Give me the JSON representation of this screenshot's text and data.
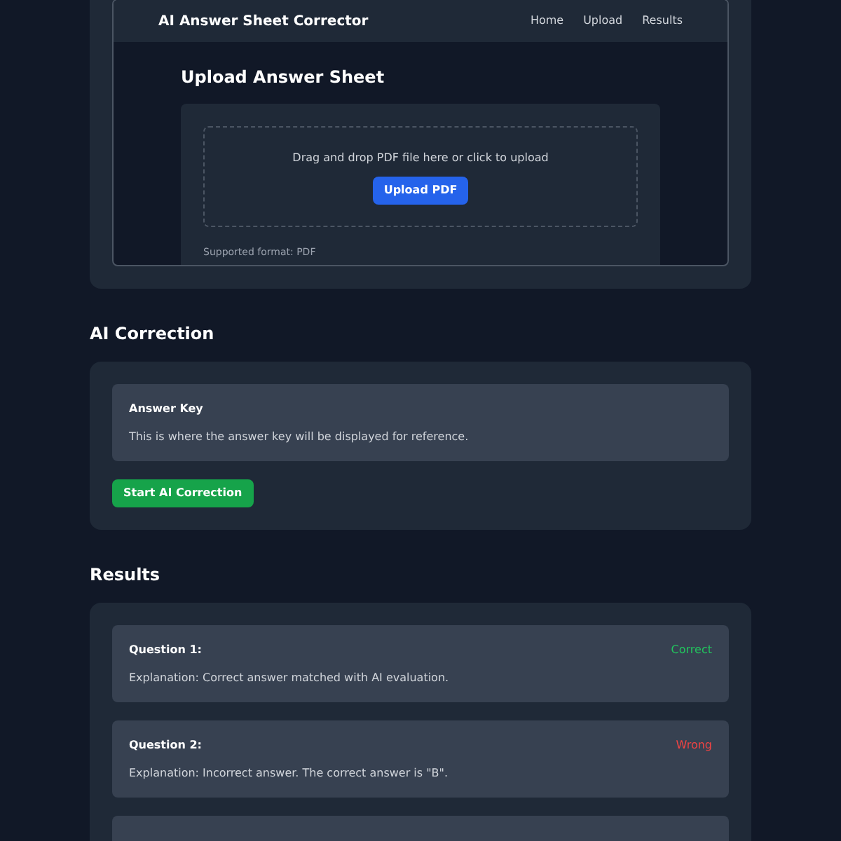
{
  "app_frame": {
    "nav": {
      "title": "AI Answer Sheet Corrector",
      "links": [
        "Home",
        "Upload",
        "Results"
      ]
    },
    "upload": {
      "heading": "Upload Answer Sheet",
      "drop_text": "Drag and drop PDF file here or click to upload",
      "button": "Upload PDF",
      "note": "Supported format: PDF"
    }
  },
  "correction": {
    "heading": "AI Correction",
    "answer_key": {
      "title": "Answer Key",
      "text": "This is where the answer key will be displayed for reference."
    },
    "button": "Start AI Correction"
  },
  "results": {
    "heading": "Results",
    "items": [
      {
        "question": "Question 1:",
        "status": "Correct",
        "kind": "correct",
        "explanation": "Explanation: Correct answer matched with AI evaluation."
      },
      {
        "question": "Question 2:",
        "status": "Wrong",
        "kind": "wrong",
        "explanation": "Explanation: Incorrect answer. The correct answer is \"B\"."
      },
      {
        "kind": "hidden"
      }
    ]
  }
}
